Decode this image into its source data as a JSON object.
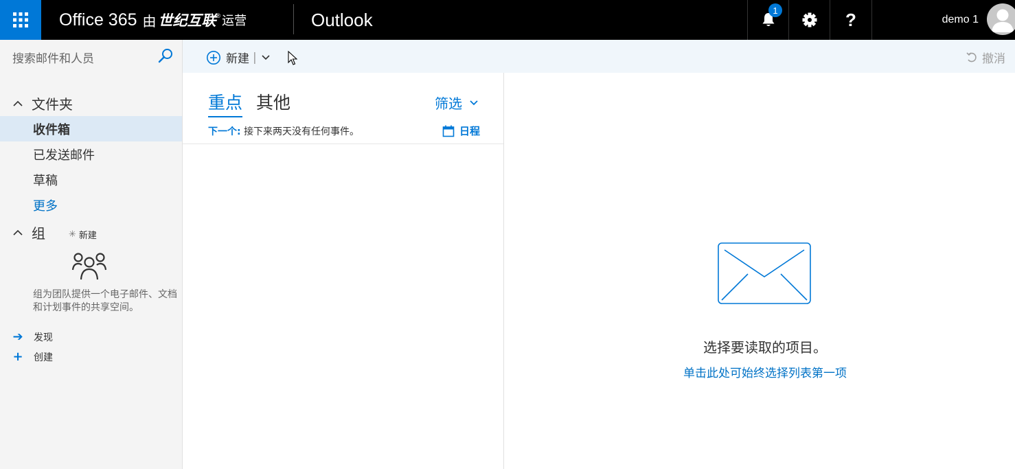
{
  "topbar": {
    "brand": "Office 365",
    "by": "由",
    "partner": "世纪互联",
    "reg": "®",
    "operated": "运营",
    "app_name": "Outlook",
    "notification_count": "1",
    "help_label": "?",
    "user_name": "demo 1"
  },
  "search": {
    "placeholder": "搜索邮件和人员"
  },
  "folders": {
    "header": "文件夹",
    "items": [
      {
        "label": "收件箱",
        "selected": true
      },
      {
        "label": "已发送邮件"
      },
      {
        "label": "草稿"
      }
    ],
    "more": "更多"
  },
  "groups": {
    "header": "组",
    "new_label": "新建",
    "description": "组为团队提供一个电子邮件、文档和计划事件的共享空间。",
    "discover": "发现",
    "create": "创建"
  },
  "commandbar": {
    "new_label": "新建",
    "undo_label": "撤消"
  },
  "maillist": {
    "tab_focused": "重点",
    "tab_other": "其他",
    "filter_label": "筛选",
    "next_label": "下一个:",
    "next_text": "接下来两天没有任何事件。",
    "schedule_label": "日程"
  },
  "reading": {
    "message": "选择要读取的项目。",
    "link": "单击此处可始终选择列表第一项"
  },
  "colors": {
    "accent": "#0078d7",
    "topbar": "#000000",
    "selected": "#dce9f5"
  }
}
